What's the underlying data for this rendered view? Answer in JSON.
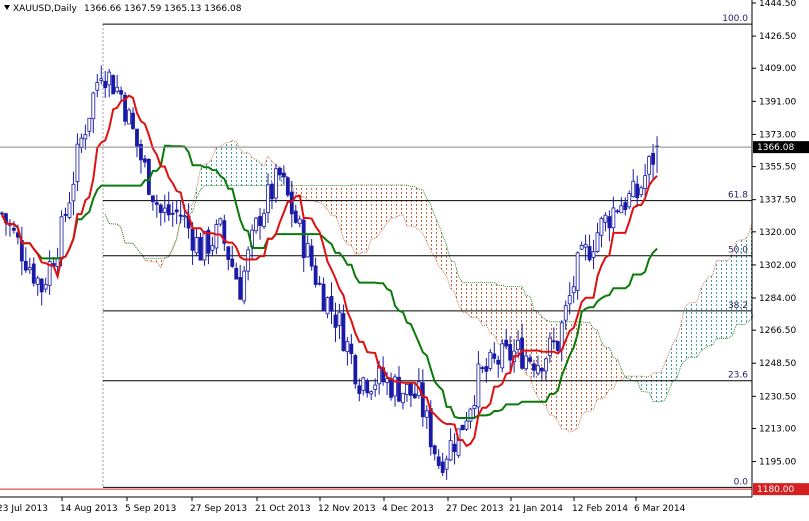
{
  "header": {
    "symbol": "XAUUSD,Daily",
    "ohlc": "1366.66 1367.59 1365.13 1366.08"
  },
  "chart_data": {
    "type": "candlestick",
    "title": "XAUUSD,Daily",
    "indicator": "Ichimoku Kinko Hyo",
    "ylim": [
      1177.5,
      1446
    ],
    "y_ticks": [
      "1444.50",
      "1426.50",
      "1409.00",
      "1391.00",
      "1373.00",
      "1355.50",
      "1337.50",
      "1320.00",
      "1302.00",
      "1284.00",
      "1266.50",
      "1248.50",
      "1230.50",
      "1213.00",
      "1195.00"
    ],
    "x_ticks": [
      "23 Jul 2013",
      "14 Aug 2013",
      "5 Sep 2013",
      "27 Sep 2013",
      "21 Oct 2013",
      "12 Nov 2013",
      "4 Dec 2013",
      "27 Dec 2013",
      "21 Jan 2014",
      "12 Feb 2014",
      "6 Mar 2014"
    ],
    "approx_closes_every_5_bars": [
      1330,
      1310,
      1290,
      1320,
      1370,
      1410,
      1395,
      1360,
      1330,
      1330,
      1310,
      1320,
      1290,
      1330,
      1350,
      1320,
      1290,
      1270,
      1240,
      1240,
      1235,
      1230,
      1195,
      1210,
      1240,
      1250,
      1255,
      1250,
      1260,
      1300,
      1320,
      1335,
      1340,
      1366
    ],
    "current_price": {
      "value": 1366.08,
      "label": "1366.08"
    },
    "alert_price": {
      "value": 1180.0,
      "label": "1180.00"
    },
    "fibonacci": [
      {
        "level": "100.0",
        "price": 1433
      },
      {
        "level": "61.8",
        "price": 1337
      },
      {
        "level": "50.0",
        "price": 1307
      },
      {
        "level": "38.2",
        "price": 1277
      },
      {
        "level": "23.6",
        "price": 1239
      },
      {
        "level": "0.0",
        "price": 1181
      }
    ],
    "colors": {
      "candle": "#1a1aa8",
      "tenkan": "#e01010",
      "kijun": "#0a7a0a",
      "cloud_bear": "#c0603a",
      "cloud_bull": "#3a9a9a",
      "fib": "#000000",
      "alert": "#d42020"
    }
  }
}
